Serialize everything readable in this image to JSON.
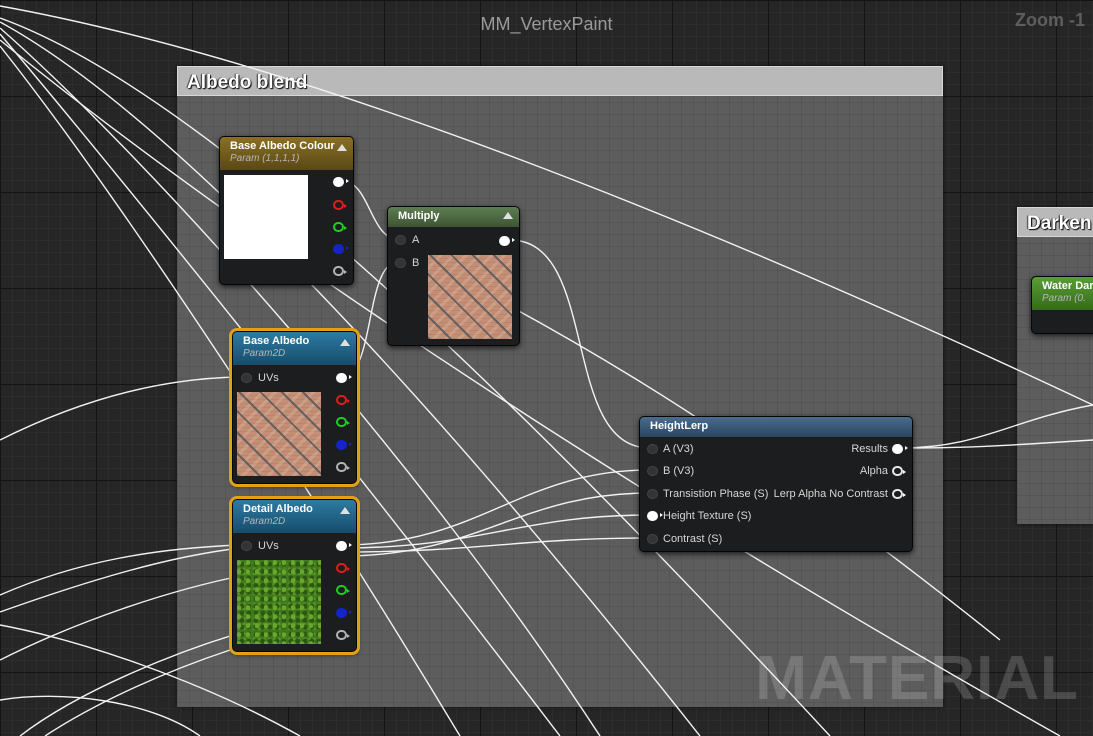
{
  "graph": {
    "title": "MM_VertexPaint",
    "zoom": "Zoom -1",
    "watermark": "MATERIAL"
  },
  "comments": [
    {
      "title": "Albedo blend"
    },
    {
      "title": "Darken"
    }
  ],
  "nodes": {
    "base_albedo_colour": {
      "title": "Base Albedo Colour",
      "subtitle": "Param (1,1,1,1)",
      "header_color": "#7e6620"
    },
    "multiply": {
      "title": "Multiply",
      "pins_in": [
        "A",
        "B"
      ],
      "header_color": "#4f6a45"
    },
    "base_albedo": {
      "title": "Base Albedo",
      "subtitle": "Param2D",
      "pin_in": "UVs",
      "header_color": "#2a6a8e"
    },
    "detail_albedo": {
      "title": "Detail Albedo",
      "subtitle": "Param2D",
      "pin_in": "UVs",
      "header_color": "#2a6a8e"
    },
    "height_lerp": {
      "title": "HeightLerp",
      "header_color": "#3c5a7a",
      "inputs": [
        "A (V3)",
        "B (V3)",
        "Transistion Phase (S)",
        "Height Texture (S)",
        "Contrast (S)"
      ],
      "outputs": [
        "Results",
        "Alpha",
        "Lerp Alpha No Contrast"
      ]
    },
    "water_darken": {
      "title": "Water Dar",
      "subtitle": "Param (0.",
      "header_color": "#4e8a2e"
    }
  },
  "icons": [
    "collapse-arrow-icon",
    "output-pin-icon",
    "input-pin-icon"
  ],
  "colors": {
    "selection": "#e3a016",
    "pin_red": "#e21b1b",
    "pin_green": "#1fd01f",
    "pin_blue": "#1424c7"
  }
}
